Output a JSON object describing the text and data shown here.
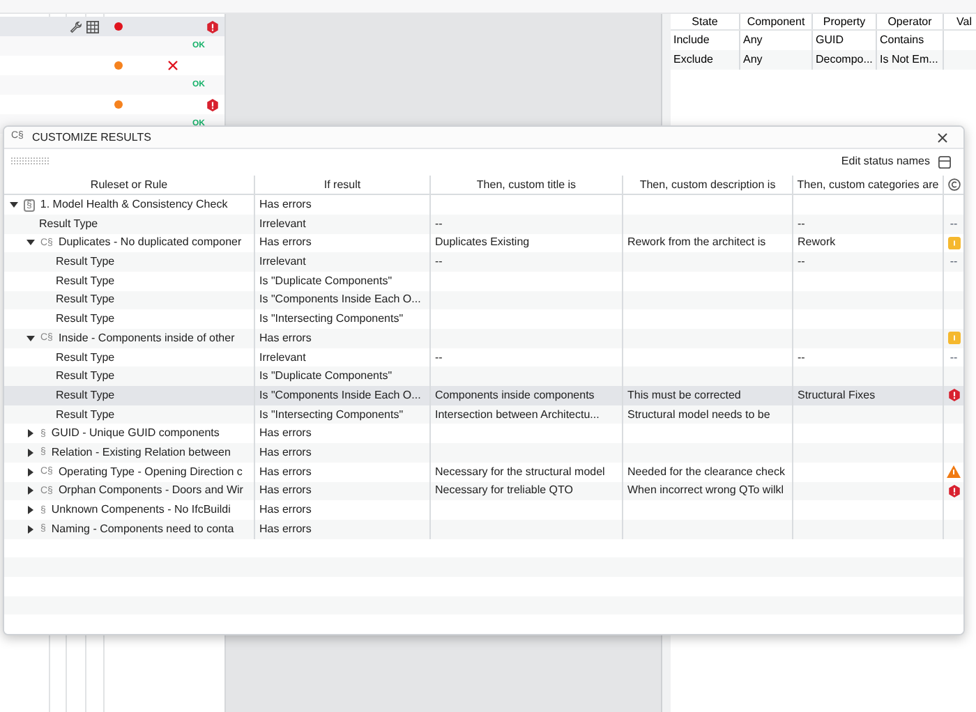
{
  "background": {
    "left_rows": [
      {
        "selected": true,
        "tools": true,
        "color": "#e0141e",
        "mark": {
          "kind": "error"
        }
      },
      {
        "selected": false,
        "tools": false,
        "mark": {
          "kind": "ok",
          "text": "OK"
        }
      },
      {
        "selected": false,
        "tools": false,
        "color": "#f5821f",
        "mark": {
          "kind": "fail"
        }
      },
      {
        "selected": false,
        "tools": false,
        "mark": {
          "kind": "ok",
          "text": "OK"
        }
      },
      {
        "selected": false,
        "tools": false,
        "color": "#f5821f",
        "mark": {
          "kind": "error"
        }
      },
      {
        "selected": false,
        "tools": false,
        "mark": {
          "kind": "ok",
          "text": "OK"
        }
      }
    ],
    "filter_table": {
      "columns": [
        "State",
        "Component",
        "Property",
        "Operator",
        "Val"
      ],
      "rows": [
        [
          "Include",
          "Any",
          "GUID",
          "Contains"
        ],
        [
          "Exclude",
          "Any",
          "Decompo...",
          "Is Not Em..."
        ]
      ]
    }
  },
  "dialog": {
    "icon_glyph": "C§",
    "title": "CUSTOMIZE RESULTS",
    "edit_status_names": "Edit status names",
    "columns": [
      "Ruleset or Rule",
      "If result",
      "Then, custom title is",
      "Then, custom description is",
      "Then, custom categories are"
    ],
    "rows": [
      {
        "icon": {
          "kind": "boxed",
          "glyph": "§"
        },
        "expanded": true,
        "selected": false,
        "name": "1. Model Health & Consistency Check",
        "if": "Has errors",
        "children": [
          {
            "name": "Result Type",
            "selected": false,
            "if": "Irrelevant",
            "title": "--",
            "categories": "--",
            "status": {
              "kind": "text",
              "text": "--"
            }
          },
          {
            "icon": {
              "kind": "plain",
              "glyph": "C§"
            },
            "expanded": true,
            "selected": false,
            "name": "Duplicates - No duplicated componer",
            "if": "Has errors",
            "title": "Duplicates Existing",
            "description": "Rework from the architect is",
            "categories": "Rework",
            "status": {
              "kind": "warning"
            },
            "children": [
              {
                "name": "Result Type",
                "selected": false,
                "if": "Irrelevant",
                "title": "--",
                "categories": "--",
                "status": {
                  "kind": "text",
                  "text": "--"
                }
              },
              {
                "name": "Result Type",
                "selected": false,
                "if": "Is \"Duplicate Components\""
              },
              {
                "name": "Result Type",
                "selected": false,
                "if": "Is \"Components Inside Each O..."
              },
              {
                "name": "Result Type",
                "selected": false,
                "if": "Is \"Intersecting Components\""
              }
            ]
          },
          {
            "icon": {
              "kind": "plain",
              "glyph": "C§"
            },
            "expanded": true,
            "selected": false,
            "name": "Inside - Components inside of other",
            "if": "Has errors",
            "status": {
              "kind": "warning"
            },
            "children": [
              {
                "name": "Result Type",
                "selected": false,
                "if": "Irrelevant",
                "title": "--",
                "categories": "--",
                "status": {
                  "kind": "text",
                  "text": "--"
                }
              },
              {
                "name": "Result Type",
                "selected": false,
                "if": "Is \"Duplicate Components\""
              },
              {
                "name": "Result Type",
                "selected": true,
                "if": "Is \"Components Inside Each O...",
                "title": "Components inside components",
                "description": "This must be corrected",
                "categories": "Structural Fixes",
                "status": {
                  "kind": "error"
                }
              },
              {
                "name": "Result Type",
                "selected": false,
                "if": "Is \"Intersecting Components\"",
                "title": "Intersection between Architectu...",
                "description": "Structural model needs to be"
              }
            ]
          },
          {
            "icon": {
              "kind": "plain",
              "glyph": "§"
            },
            "expanded": false,
            "selected": false,
            "name": "GUID - Unique GUID components",
            "if": "Has errors"
          },
          {
            "icon": {
              "kind": "plain",
              "glyph": "§"
            },
            "expanded": false,
            "selected": false,
            "name": "Relation - Existing Relation between",
            "if": "Has errors"
          },
          {
            "icon": {
              "kind": "plain",
              "glyph": "C§"
            },
            "expanded": false,
            "selected": false,
            "name": "Operating Type - Opening Direction c",
            "if": "Has errors",
            "title": "Necessary for the structural model",
            "description": "Needed for the clearance check",
            "status": {
              "kind": "caution"
            }
          },
          {
            "icon": {
              "kind": "plain",
              "glyph": "C§"
            },
            "expanded": false,
            "selected": false,
            "name": "Orphan Components - Doors and Wir",
            "if": "Has errors",
            "title": "Necessary for treliable QTO",
            "description": "When incorrect wrong QTo wilkl",
            "status": {
              "kind": "error"
            }
          },
          {
            "icon": {
              "kind": "plain",
              "glyph": "§"
            },
            "expanded": false,
            "selected": false,
            "name": "Unknown  Compenents - No IfcBuildi",
            "if": "Has errors"
          },
          {
            "icon": {
              "kind": "plain",
              "glyph": "§"
            },
            "expanded": false,
            "selected": false,
            "name": "Naming - Components need to conta",
            "if": "Has errors"
          }
        ]
      }
    ]
  }
}
